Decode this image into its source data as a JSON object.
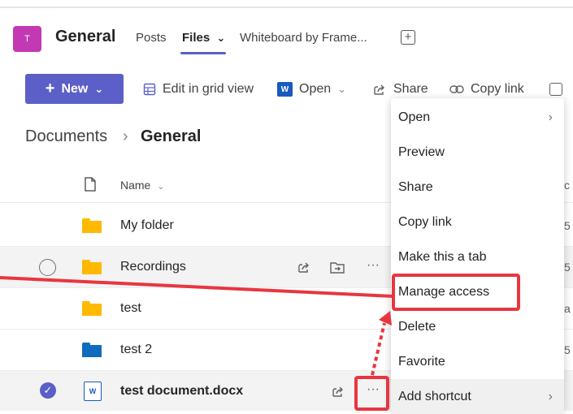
{
  "header": {
    "avatar_letter": "T",
    "team_name": "General",
    "tabs": [
      "Posts",
      "Files",
      "Whiteboard by Frame..."
    ],
    "active_tab": "Files",
    "files_chevron": "⌄",
    "add_tab_symbol": "+"
  },
  "toolbar": {
    "new_label": "New",
    "edit_grid_label": "Edit in grid view",
    "word_letter": "W",
    "open_label": "Open",
    "share_label": "Share",
    "copy_link_label": "Copy link"
  },
  "breadcrumb": {
    "root": "Documents",
    "separator": "›",
    "current": "General"
  },
  "list": {
    "name_header": "Name",
    "rows": [
      {
        "name": "My folder",
        "type": "folder",
        "color": "#ffb900"
      },
      {
        "name": "Recordings",
        "type": "folder",
        "color": "#ffb900",
        "selected": false
      },
      {
        "name": "test",
        "type": "folder",
        "color": "#ffb900"
      },
      {
        "name": "test 2",
        "type": "folder",
        "color": "#0f6cbd"
      },
      {
        "name": "test document.docx",
        "type": "docx",
        "checked": true
      }
    ],
    "more_symbol": "···",
    "right_fragments": [
      "c",
      "5",
      "5",
      "a",
      "5"
    ]
  },
  "context_menu": {
    "items": [
      "Open",
      "Preview",
      "Share",
      "Copy link",
      "Make this a tab",
      "Manage access",
      "Delete",
      "Favorite",
      "Add shortcut"
    ],
    "submenu_chevron": "›"
  },
  "colors": {
    "accent": "#5b5fc7",
    "annotation_red": "#e8363f",
    "avatar": "#c239b3",
    "folder_yellow": "#ffb900",
    "folder_blue": "#0f6cbd",
    "word_blue": "#185abd"
  }
}
